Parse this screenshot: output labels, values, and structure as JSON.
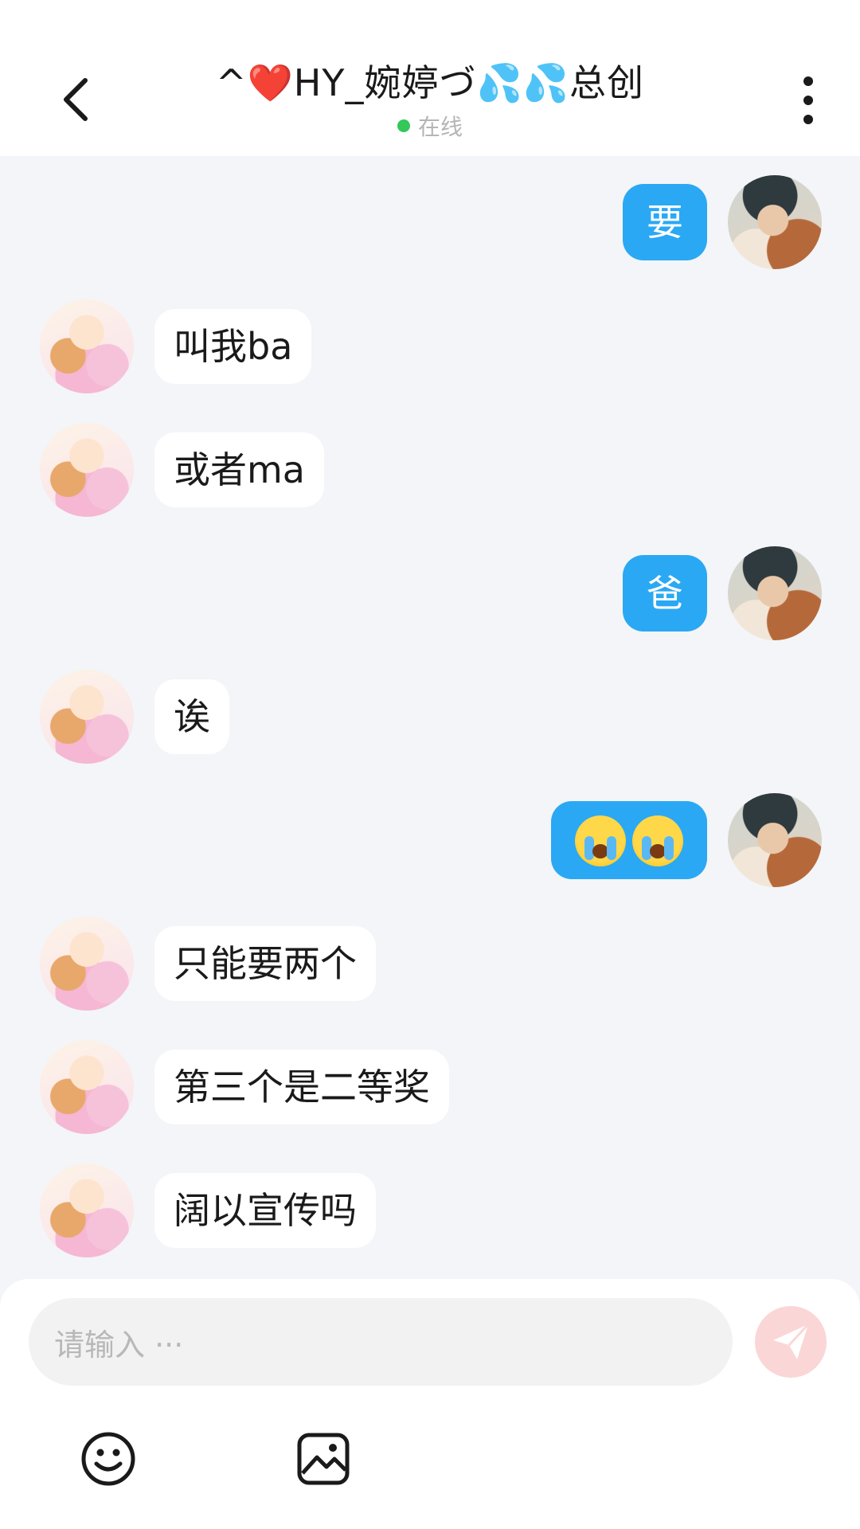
{
  "header": {
    "title": "^❤️HY_婉婷づ💦💦总创",
    "status": "在线",
    "status_color": "#34c759",
    "back_icon": "chevron-left-icon",
    "more_icon": "more-vertical-icon"
  },
  "messages": [
    {
      "side": "right",
      "text": "要"
    },
    {
      "side": "left",
      "text": "叫我ba"
    },
    {
      "side": "left",
      "text": "或者ma"
    },
    {
      "side": "right",
      "text": "爸"
    },
    {
      "side": "left",
      "text": "诶"
    },
    {
      "side": "right",
      "text": "😭😭",
      "emoji": "loudly-crying-face"
    },
    {
      "side": "left",
      "text": "只能要两个"
    },
    {
      "side": "left",
      "text": "第三个是二等奖"
    },
    {
      "side": "left",
      "text": "阔以宣传吗"
    }
  ],
  "composer": {
    "placeholder": "请输入 ···",
    "send_icon": "send-icon",
    "emoji_icon": "emoji-icon",
    "image_icon": "image-icon"
  },
  "colors": {
    "accent": "#2aa8f4",
    "background": "#f3f5f8",
    "send_button": "#fbd6d6"
  }
}
